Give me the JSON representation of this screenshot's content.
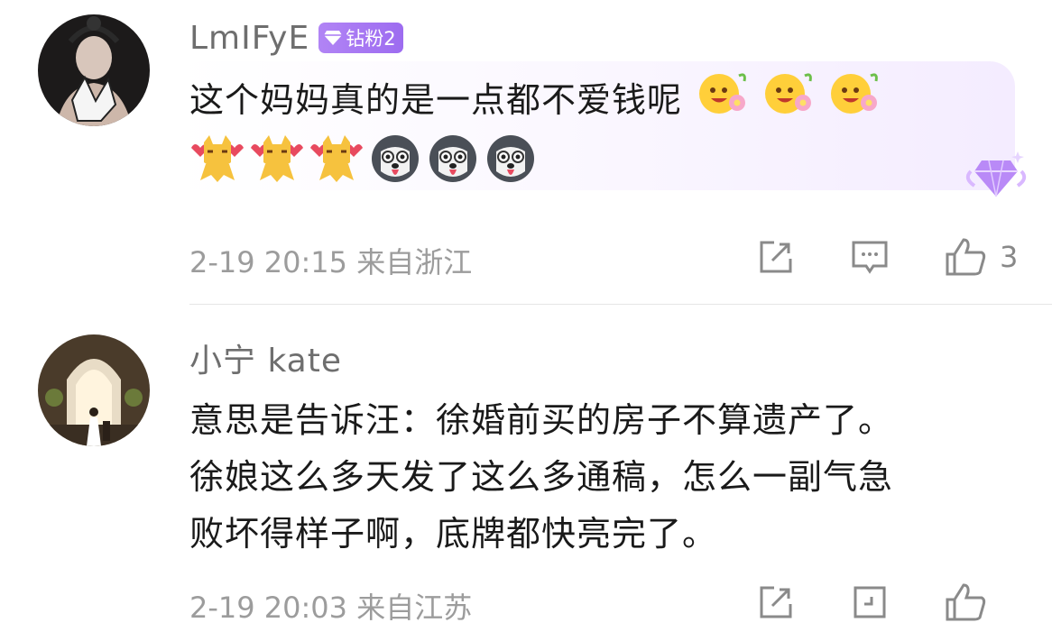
{
  "comments": [
    {
      "username": "LmIFyE",
      "badge": "钻粉2",
      "text": "这个妈妈真的是一点都不爱钱呢",
      "emojis_line1": [
        "flower-face-emoji",
        "flower-face-emoji",
        "flower-face-emoji"
      ],
      "emojis_line2": [
        "dog-heart-emoji",
        "dog-heart-emoji",
        "dog-heart-emoji",
        "husky-emoji",
        "husky-emoji",
        "husky-emoji"
      ],
      "date": "2-19 20:15",
      "location": "来自浙江",
      "likes": "3"
    },
    {
      "username": "小宁 kate",
      "text_lines": [
        "意思是告诉汪：徐婚前买的房子不算遗产了。",
        "徐娘这么多天发了这么多通稿，怎么一副气急",
        "败坏得样子啊，底牌都快亮完了。"
      ],
      "date": "2-19 20:03",
      "location": "来自江苏",
      "likes": ""
    }
  ],
  "colors": {
    "username": "#6e6e6e",
    "text": "#1a1a1a",
    "meta": "#9c9c9c",
    "badge": "#a878f3"
  }
}
